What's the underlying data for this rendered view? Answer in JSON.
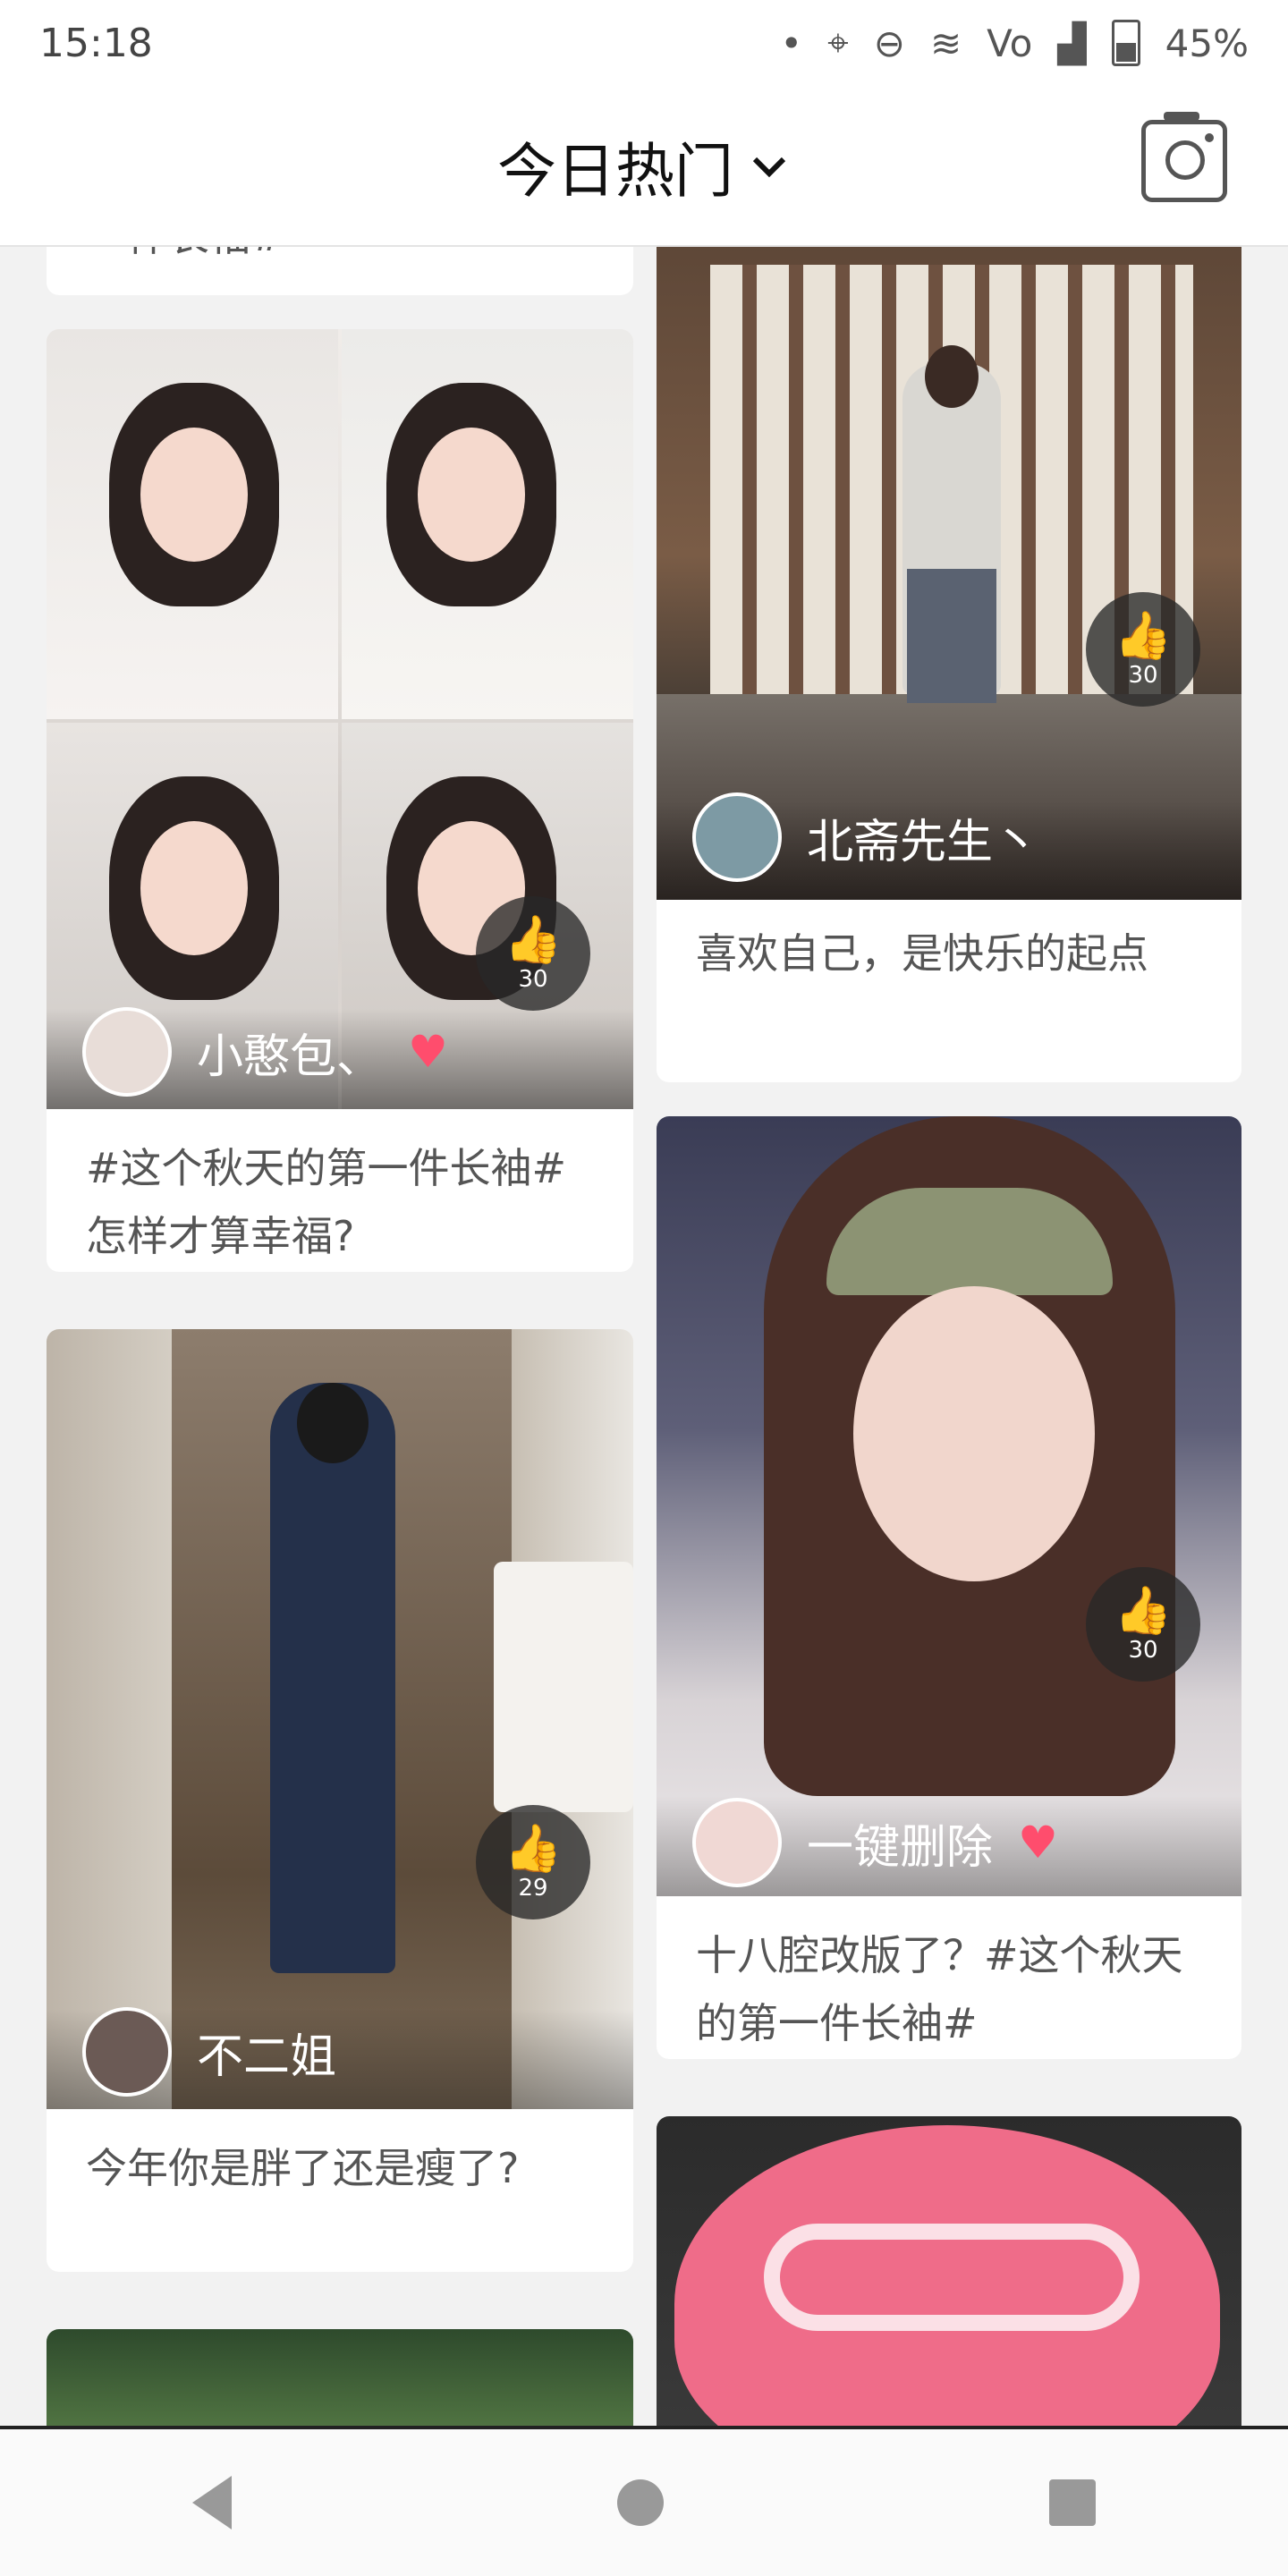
{
  "status_bar": {
    "time": "15:18",
    "battery": "45%"
  },
  "header": {
    "title": "今日热门",
    "dropdown_icon": "chevron-down-icon",
    "camera_icon": "camera-icon"
  },
  "feed": {
    "top_partial_caption": "一件长袖#",
    "cards": [
      {
        "id": "left-1",
        "username": "小憨包、",
        "likes": "30",
        "caption": "#这个秋天的第一件长袖# 怎样才算幸福?",
        "verified_heart": true
      },
      {
        "id": "left-2",
        "username": "不二姐",
        "likes": "29",
        "caption": "今年你是胖了还是瘦了?"
      },
      {
        "id": "right-1",
        "username": "北斋先生丶",
        "likes": "30",
        "caption": "喜欢自己，是快乐的起点"
      },
      {
        "id": "right-2",
        "username": "一键删除",
        "likes": "30",
        "caption": "十八腔改版了？#这个秋天的第一件长袖#",
        "verified_heart": true
      },
      {
        "id": "right-3",
        "username": "",
        "likes": "",
        "caption": ""
      }
    ]
  },
  "nav_bar": {
    "back_icon": "back-icon",
    "home_icon": "home-icon",
    "recents_icon": "recents-icon"
  },
  "colors": {
    "accent_heart": "#ff4d6d",
    "background": "#f2f2f2"
  }
}
